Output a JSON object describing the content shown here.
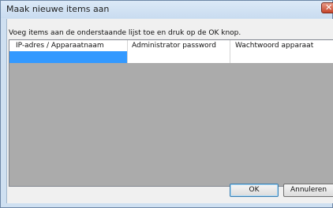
{
  "window": {
    "title": "Maak nieuwe items aan"
  },
  "instruction": "Voeg items aan de onderstaande lijst toe en druk op de OK knop.",
  "table": {
    "columns": [
      "IP-adres / Apparaatnaam",
      "Administrator password",
      "Wachtwoord apparaat"
    ],
    "rows": [
      [
        "",
        "",
        ""
      ]
    ],
    "selected_cell": "IP-adres / Apparaatnaam"
  },
  "buttons": {
    "ok_label": "OK",
    "cancel_label": "Annuleren"
  },
  "colors": {
    "selection": "#3399ff",
    "table_background": "#ababab",
    "window_frame": "#cfe0f1"
  },
  "icons": {
    "close": "close-icon"
  }
}
